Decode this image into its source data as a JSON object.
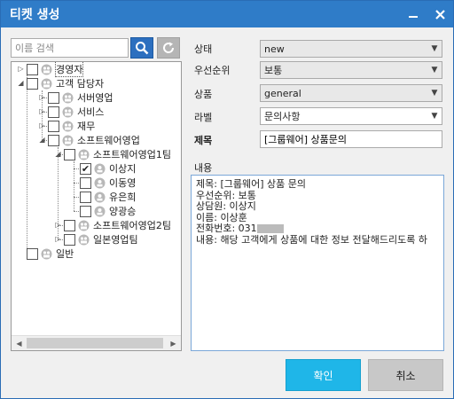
{
  "window": {
    "title": "티켓 생성"
  },
  "search": {
    "placeholder": "이름 검색"
  },
  "tree": {
    "nodes": [
      {
        "label": "경영자"
      },
      {
        "label": "고객 담당자"
      },
      {
        "label": "서버영업"
      },
      {
        "label": "서비스"
      },
      {
        "label": "재무"
      },
      {
        "label": "소프트웨어영업"
      },
      {
        "label": "소프트웨어영업1팀"
      },
      {
        "label": "이상지",
        "checked": true
      },
      {
        "label": "이동영"
      },
      {
        "label": "유은희"
      },
      {
        "label": "양광승"
      },
      {
        "label": "소프트웨어영업2팀"
      },
      {
        "label": "일본영업팀"
      },
      {
        "label": "일반"
      }
    ]
  },
  "form": {
    "status_label": "상태",
    "status_value": "new",
    "priority_label": "우선순위",
    "priority_value": "보통",
    "product_label": "상품",
    "product_value": "general",
    "label_label": "라벨",
    "label_value": "문의사항",
    "subject_label": "제목",
    "subject_value": "[그룹웨어] 상품문의",
    "content_label": "내용",
    "content_lines": [
      "제목: [그룹웨어] 상품 문의",
      "우선순위: 보통",
      "상담원: 이상지",
      "이름: 이상훈",
      "전화번호: 031",
      "내용: 해당 고객에게 상품에 대한 정보 전달해드리도록 하"
    ]
  },
  "buttons": {
    "ok": "확인",
    "cancel": "취소"
  },
  "colors": {
    "titlebar": "#2f7cc8",
    "ok": "#1fb6e8",
    "cancel": "#c8c8c8",
    "search_button": "#2c6fbf"
  }
}
